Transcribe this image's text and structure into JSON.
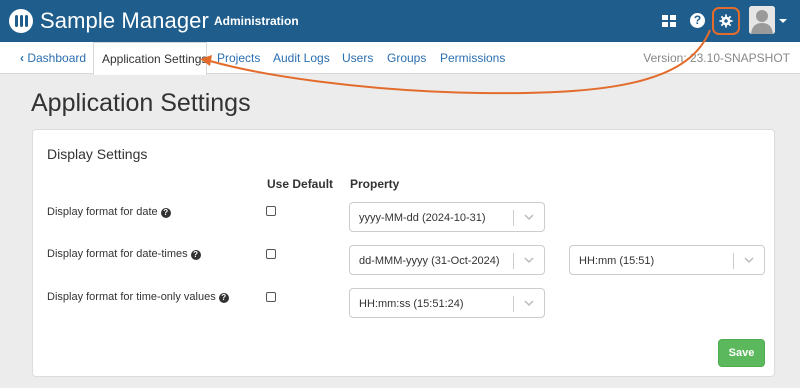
{
  "header": {
    "app_name": "Sample Manager",
    "section": "Administration",
    "icons": [
      "app-grid-icon",
      "help-icon",
      "gear-icon",
      "user-avatar-icon"
    ],
    "help_glyph": "?"
  },
  "subnav": {
    "back_label": "Dashboard",
    "active_tab": "Application Settings",
    "tabs": [
      "Projects",
      "Audit Logs",
      "Users",
      "Groups",
      "Permissions"
    ],
    "version": "Version: 23.10-SNAPSHOT"
  },
  "page": {
    "title": "Application Settings"
  },
  "display_settings": {
    "title": "Display Settings",
    "col_use_default": "Use Default",
    "col_property": "Property",
    "rows": [
      {
        "label": "Display format for date",
        "use_default": false,
        "property": "yyyy-MM-dd (2024-10-31)"
      },
      {
        "label": "Display format for date-times",
        "use_default": false,
        "property": "dd-MMM-yyyy (31-Oct-2024)",
        "time_property": "HH:mm (15:51)"
      },
      {
        "label": "Display format for time-only values",
        "use_default": false,
        "property": "HH:mm:ss (15:51:24)"
      }
    ],
    "save_label": "Save"
  },
  "colors": {
    "header_bg": "#1f5e8c",
    "link": "#2a6fb0",
    "save_bg": "#5cb85c",
    "annotation": "#e36c2c"
  }
}
